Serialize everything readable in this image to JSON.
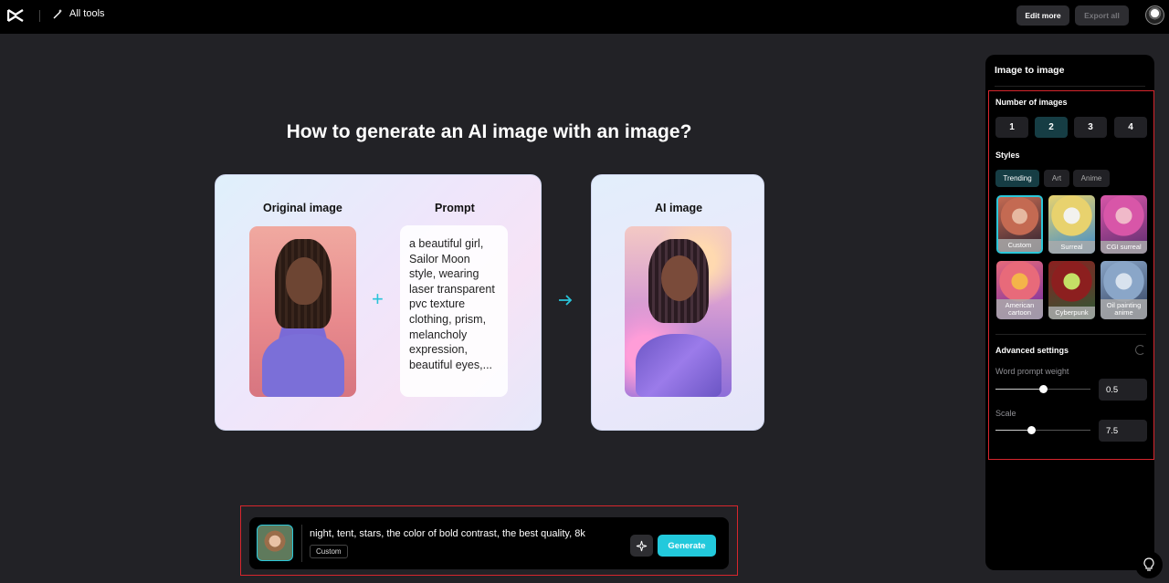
{
  "topbar": {
    "all_tools_label": "All tools",
    "edit_more_label": "Edit more",
    "export_all_label": "Export all"
  },
  "main": {
    "title": "How to generate an AI image with an image?",
    "original_label": "Original image",
    "prompt_label": "Prompt",
    "prompt_text": "a beautiful girl, Sailor Moon style, wearing laser transparent pvc texture clothing, prism, melancholy expression, beautiful eyes,...",
    "ai_label": "AI image"
  },
  "prompt_bar": {
    "text": "night, tent, stars, the color of bold contrast, the best quality, 8k",
    "style_tag": "Custom",
    "generate_label": "Generate"
  },
  "panel": {
    "title": "Image to image",
    "number_label": "Number of images",
    "numbers": [
      "1",
      "2",
      "3",
      "4"
    ],
    "selected_number": "2",
    "styles_label": "Styles",
    "style_tabs": [
      "Trending",
      "Art",
      "Anime"
    ],
    "active_tab": "Trending",
    "styles": [
      {
        "label": "Custom",
        "selected": true,
        "colors": [
          "#c46a52",
          "#2c2230",
          "#e6b8a0"
        ]
      },
      {
        "label": "Surreal",
        "selected": false,
        "colors": [
          "#e8d26e",
          "#3c8ccc",
          "#f2f2ee"
        ]
      },
      {
        "label": "CGI surreal",
        "selected": false,
        "colors": [
          "#d856a8",
          "#5a2c6e",
          "#f0b9c9"
        ]
      },
      {
        "label": "American cartoon",
        "selected": false,
        "colors": [
          "#e86a7a",
          "#6c2aa8",
          "#f4b44a"
        ]
      },
      {
        "label": "Cyberpunk",
        "selected": false,
        "colors": [
          "#8c1f1f",
          "#2a5c36",
          "#c4e066"
        ]
      },
      {
        "label": "Oil painting anime",
        "selected": false,
        "colors": [
          "#8aa6c8",
          "#2e3c5a",
          "#d8e2ee"
        ]
      }
    ],
    "advanced_label": "Advanced settings",
    "weight_label": "Word prompt weight",
    "weight_value": "0.5",
    "weight_fraction": 0.5,
    "scale_label": "Scale",
    "scale_value": "7.5",
    "scale_fraction": 0.38
  }
}
